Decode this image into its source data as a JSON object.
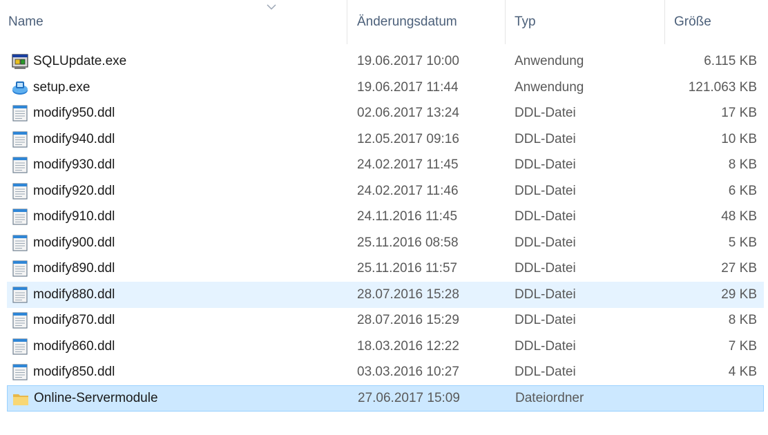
{
  "columns": {
    "name": "Name",
    "modified": "Änderungsdatum",
    "type": "Typ",
    "size": "Größe"
  },
  "files": [
    {
      "name": "SQLUpdate.exe",
      "modified": "19.06.2017 10:00",
      "type": "Anwendung",
      "size": "6.115 KB",
      "icon": "sqlupdate-exe-icon"
    },
    {
      "name": "setup.exe",
      "modified": "19.06.2017 11:44",
      "type": "Anwendung",
      "size": "121.063 KB",
      "icon": "setup-exe-icon"
    },
    {
      "name": "modify950.ddl",
      "modified": "02.06.2017 13:24",
      "type": "DDL-Datei",
      "size": "17 KB",
      "icon": "ddl-file-icon"
    },
    {
      "name": "modify940.ddl",
      "modified": "12.05.2017 09:16",
      "type": "DDL-Datei",
      "size": "10 KB",
      "icon": "ddl-file-icon"
    },
    {
      "name": "modify930.ddl",
      "modified": "24.02.2017 11:45",
      "type": "DDL-Datei",
      "size": "8 KB",
      "icon": "ddl-file-icon"
    },
    {
      "name": "modify920.ddl",
      "modified": "24.02.2017 11:46",
      "type": "DDL-Datei",
      "size": "6 KB",
      "icon": "ddl-file-icon"
    },
    {
      "name": "modify910.ddl",
      "modified": "24.11.2016 11:45",
      "type": "DDL-Datei",
      "size": "48 KB",
      "icon": "ddl-file-icon"
    },
    {
      "name": "modify900.ddl",
      "modified": "25.11.2016 08:58",
      "type": "DDL-Datei",
      "size": "5 KB",
      "icon": "ddl-file-icon"
    },
    {
      "name": "modify890.ddl",
      "modified": "25.11.2016 11:57",
      "type": "DDL-Datei",
      "size": "27 KB",
      "icon": "ddl-file-icon"
    },
    {
      "name": "modify880.ddl",
      "modified": "28.07.2016 15:28",
      "type": "DDL-Datei",
      "size": "29 KB",
      "icon": "ddl-file-icon",
      "state": "hover"
    },
    {
      "name": "modify870.ddl",
      "modified": "28.07.2016 15:29",
      "type": "DDL-Datei",
      "size": "8 KB",
      "icon": "ddl-file-icon"
    },
    {
      "name": "modify860.ddl",
      "modified": "18.03.2016 12:22",
      "type": "DDL-Datei",
      "size": "7 KB",
      "icon": "ddl-file-icon"
    },
    {
      "name": "modify850.ddl",
      "modified": "03.03.2016 10:27",
      "type": "DDL-Datei",
      "size": "4 KB",
      "icon": "ddl-file-icon"
    },
    {
      "name": "Online-Servermodule",
      "modified": "27.06.2017 15:09",
      "type": "Dateiordner",
      "size": "",
      "icon": "folder-icon",
      "state": "selected"
    }
  ],
  "colors": {
    "header_text": "#4c607a",
    "hover_bg": "#e5f3ff",
    "selected_bg": "#cce8ff",
    "selected_border": "#99d1ff"
  }
}
